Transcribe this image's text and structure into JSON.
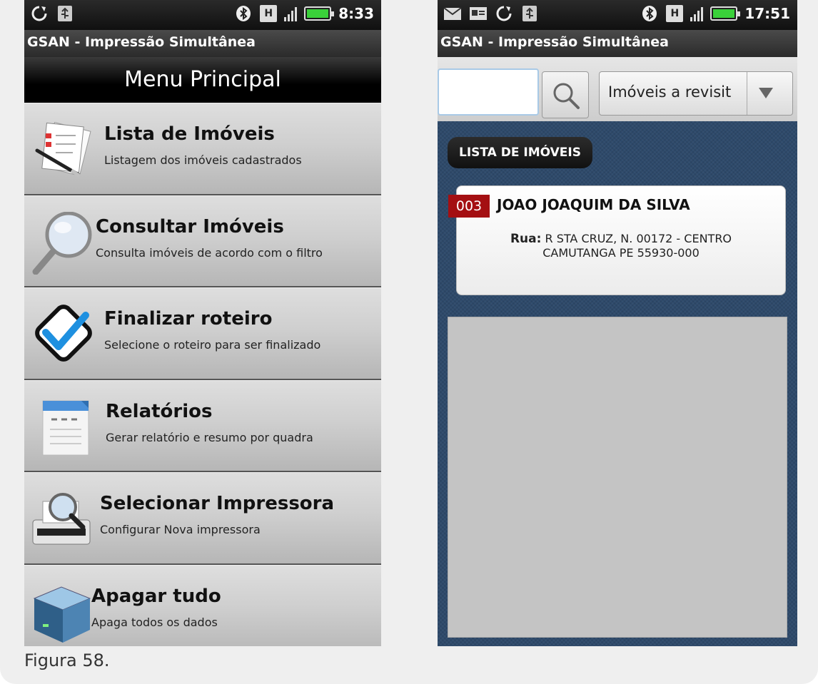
{
  "screen1": {
    "status": {
      "left_icons": [
        "sync-icon",
        "usb-icon"
      ],
      "right_icons": [
        "bluetooth-icon",
        "h-network-icon",
        "signal-icon",
        "battery-charging-icon"
      ],
      "time": "8:33",
      "h_badge": "H"
    },
    "app_title": "GSAN - Impressão Simultânea",
    "menu_title": "Menu Principal",
    "menu_items": [
      {
        "icon": "document-list-icon",
        "title": "Lista de Imóveis",
        "subtitle": "Listagem dos imóveis cadastrados"
      },
      {
        "icon": "magnifier-icon",
        "title": "Consultar Imóveis",
        "subtitle": "Consulta imóveis de acordo com o filtro"
      },
      {
        "icon": "checkmark-icon",
        "title": "Finalizar roteiro",
        "subtitle": "Selecione o roteiro para ser finalizado"
      },
      {
        "icon": "report-icon",
        "title": "Relatórios",
        "subtitle": "Gerar relatório e resumo por quadra"
      },
      {
        "icon": "printer-search-icon",
        "title": "Selecionar Impressora",
        "subtitle": "Configurar Nova impressora"
      },
      {
        "icon": "trash-bin-icon",
        "title": "Apagar tudo",
        "subtitle": "Apaga todos os dados"
      }
    ]
  },
  "screen2": {
    "status": {
      "left_icons": [
        "mail-icon",
        "card-icon",
        "sync-icon",
        "usb-icon"
      ],
      "right_icons": [
        "bluetooth-icon",
        "h-network-icon",
        "signal-icon",
        "battery-icon"
      ],
      "time": "17:51",
      "h_badge": "H"
    },
    "app_title": "GSAN - Impressão Simultânea",
    "search": {
      "value": ""
    },
    "filter": {
      "selected": "Imóveis a revisit"
    },
    "list_label": "LISTA DE IMÓVEIS",
    "properties": [
      {
        "number": "003",
        "owner": "JOAO JOAQUIM DA SILVA",
        "street_label": "Rua:",
        "street": "R STA CRUZ, N. 00172 - CENTRO",
        "city_line": "CAMUTANGA PE 55930-000"
      }
    ]
  },
  "caption": "Figura 58."
}
